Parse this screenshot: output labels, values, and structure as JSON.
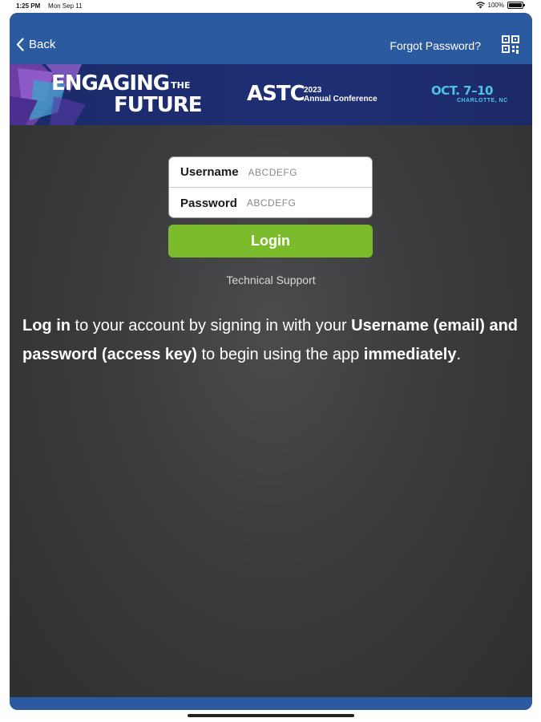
{
  "status_bar": {
    "time": "1:25 PM",
    "date": "Mon Sep 11",
    "battery": "100%"
  },
  "navbar": {
    "back_label": "Back",
    "forgot_label": "Forgot Password?",
    "qr_icon": "qr-code-icon",
    "color": "#2c5aa0"
  },
  "banner": {
    "title_line1": "ENGAGING",
    "title_the": "THE",
    "title_line2": "FUTURE",
    "org": "ASTC",
    "year": "2023",
    "event": "Annual Conference",
    "dates": "OCT. 7–10",
    "city": "CHARLOTTE, NC"
  },
  "form": {
    "username_label": "Username",
    "username_value": "ABCDEFG",
    "password_label": "Password",
    "password_value": "ABCDEFG",
    "login_label": "Login",
    "login_color": "#7cbb2b"
  },
  "support": {
    "label": "Technical Support"
  },
  "intro": {
    "p1_bold": "Log in",
    "p1_text": " to your account by signing in with your ",
    "p2_bold": "Username (email) and password (access key)",
    "p2_text": " to begin using the app ",
    "p3_bold": "immediately",
    "p3_text": "."
  }
}
